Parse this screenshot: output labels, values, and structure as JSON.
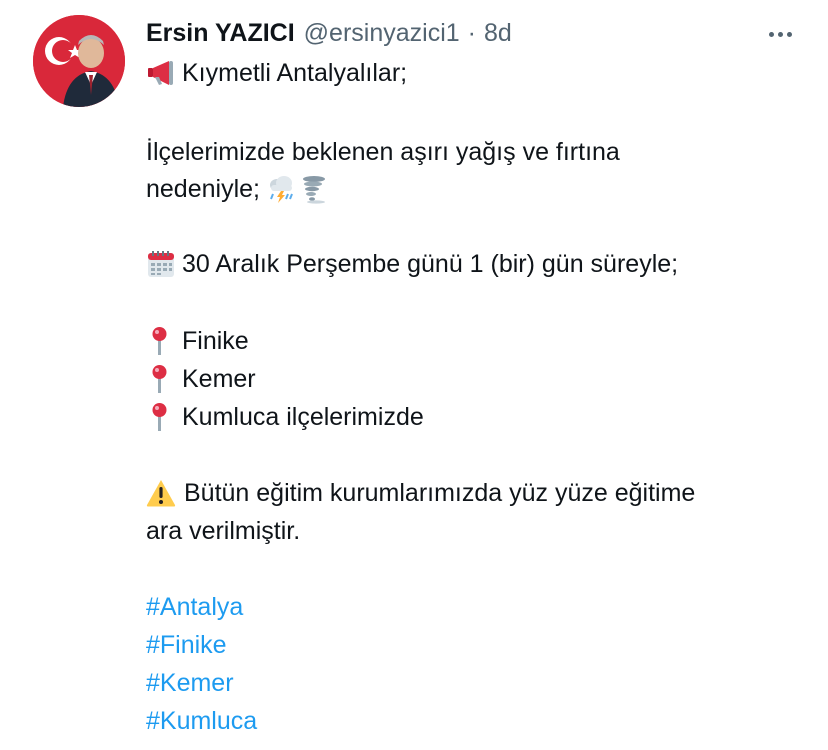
{
  "author": {
    "display_name": "Ersin YAZICI",
    "handle": "@ersinyazici1",
    "separator": "·",
    "time": "8d"
  },
  "tweet": {
    "line1": "Kıymetli Antalyalılar;",
    "line2": "İlçelerimizde beklenen aşırı yağış ve fırtına",
    "line3": "nedeniyle;",
    "line4": "30 Aralık Perşembe günü 1 (bir) gün süreyle;",
    "place1": "Finike",
    "place2": "Kemer",
    "place3": "Kumluca ilçelerimizde",
    "line8": "Bütün eğitim kurumlarımızda yüz yüze eğitime",
    "line9": "ara verilmiştir.",
    "hashtags": [
      "#Antalya",
      "#Finike",
      "#Kemer",
      "#Kumluca"
    ]
  },
  "icons": {
    "megaphone": "megaphone-icon",
    "storm": "cloud-lightning-rain-icon",
    "tornado": "tornado-icon",
    "calendar": "calendar-icon",
    "pin": "round-pushpin-icon",
    "warning": "warning-icon",
    "more": "more-options-icon"
  },
  "colors": {
    "text": "#0f1419",
    "secondary": "#536471",
    "hashtag": "#1d9bf0",
    "flag_red": "#d9283a"
  }
}
